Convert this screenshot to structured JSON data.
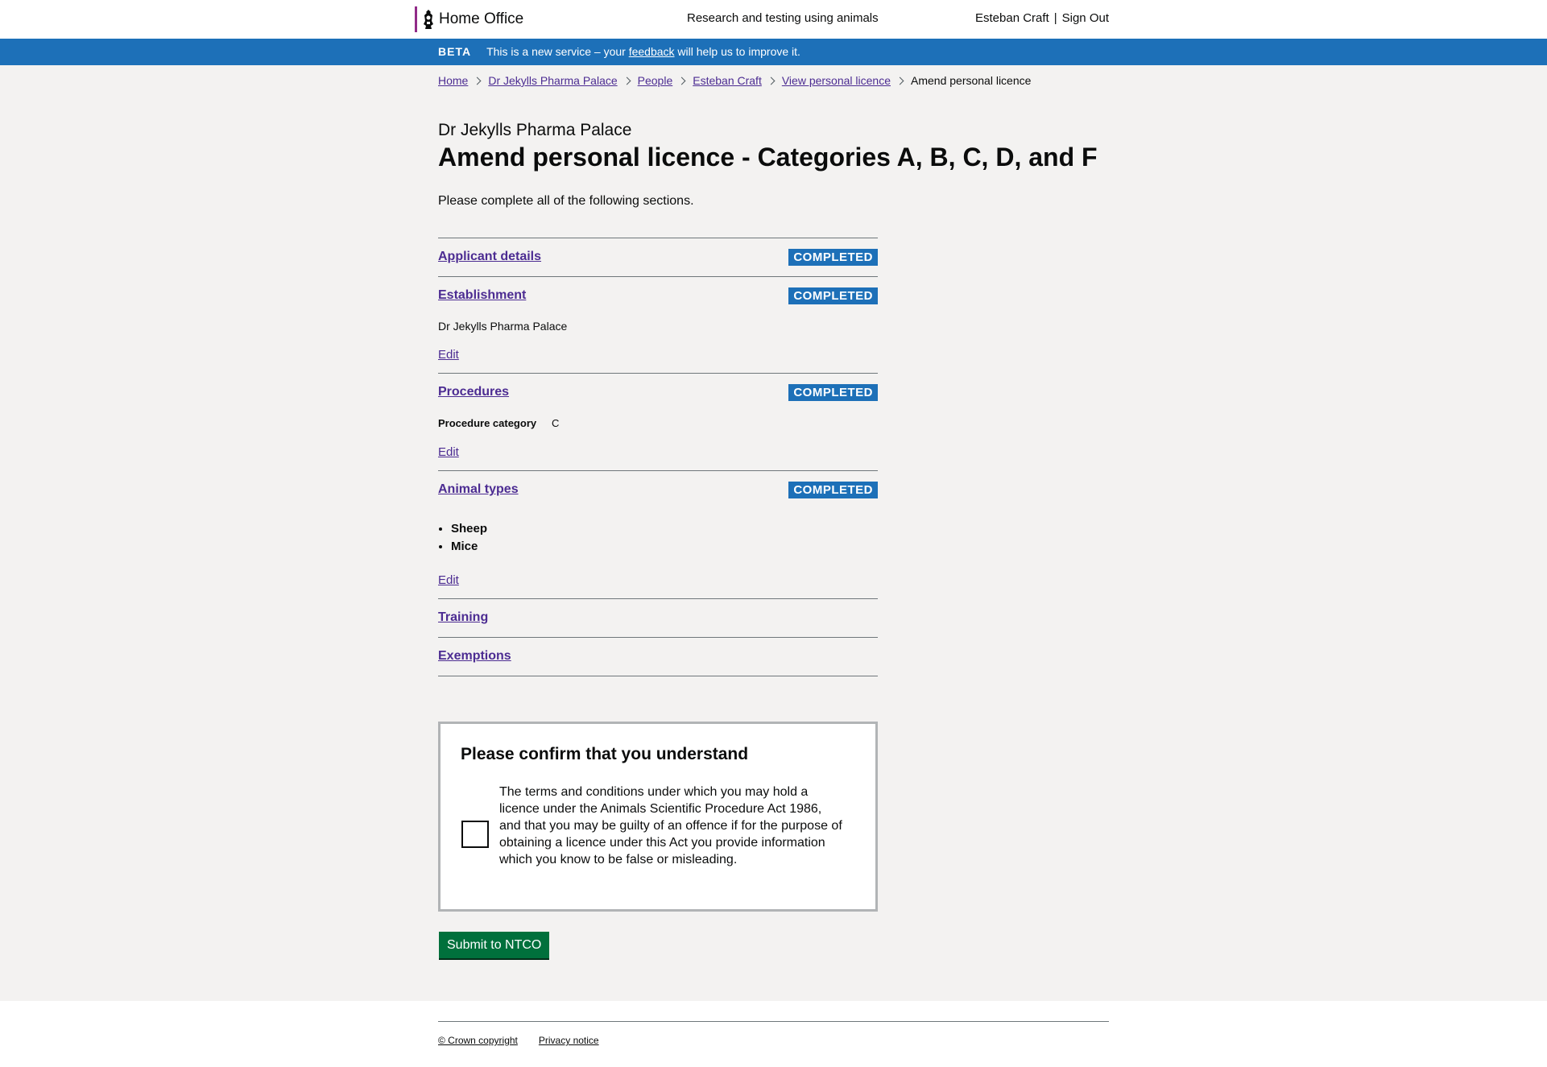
{
  "header": {
    "brand": "Home Office",
    "service_name": "Research and testing using animals",
    "user_name": "Esteban Craft",
    "separator": "|",
    "sign_out": "Sign Out"
  },
  "beta_banner": {
    "tag": "BETA",
    "text_before": "This is a new service – your",
    "link": "feedback",
    "text_after": "will help us to improve it."
  },
  "breadcrumb": {
    "items": [
      "Home",
      "Dr Jekylls Pharma Palace",
      "People",
      "Esteban Craft",
      "View personal licence"
    ],
    "current": "Amend personal licence"
  },
  "page": {
    "caption": "Dr Jekylls Pharma Palace",
    "title": "Amend personal licence - Categories A, B, C, D, and F",
    "intro": "Please complete all of the following sections."
  },
  "tasks": {
    "status_completed": "COMPLETED",
    "edit_label": "Edit",
    "applicant": {
      "label": "Applicant details"
    },
    "establishment": {
      "label": "Establishment",
      "value": "Dr Jekylls Pharma Palace"
    },
    "procedures": {
      "label": "Procedures",
      "key": "Procedure category",
      "value": "C"
    },
    "animal_types": {
      "label": "Animal types",
      "items": [
        "Sheep",
        "Mice"
      ]
    },
    "training": {
      "label": "Training"
    },
    "exemptions": {
      "label": "Exemptions"
    }
  },
  "confirm": {
    "title": "Please confirm that you understand",
    "text": "The terms and conditions under which you may hold a licence under the Animals Scientific Procedure Act 1986, and that you may be guilty of an offence if for the purpose of obtaining a licence under this Act you provide information which you know to be false or misleading."
  },
  "submit_label": "Submit to NTCO",
  "footer": {
    "copyright": "© Crown copyright",
    "privacy": "Privacy notice"
  },
  "colors": {
    "brand_bar": "#912b88",
    "banner": "#1d70b8",
    "tag": "#1d70b8",
    "link": "#4c2c92",
    "submit": "#00703c",
    "page_bg": "#f3f2f1"
  }
}
